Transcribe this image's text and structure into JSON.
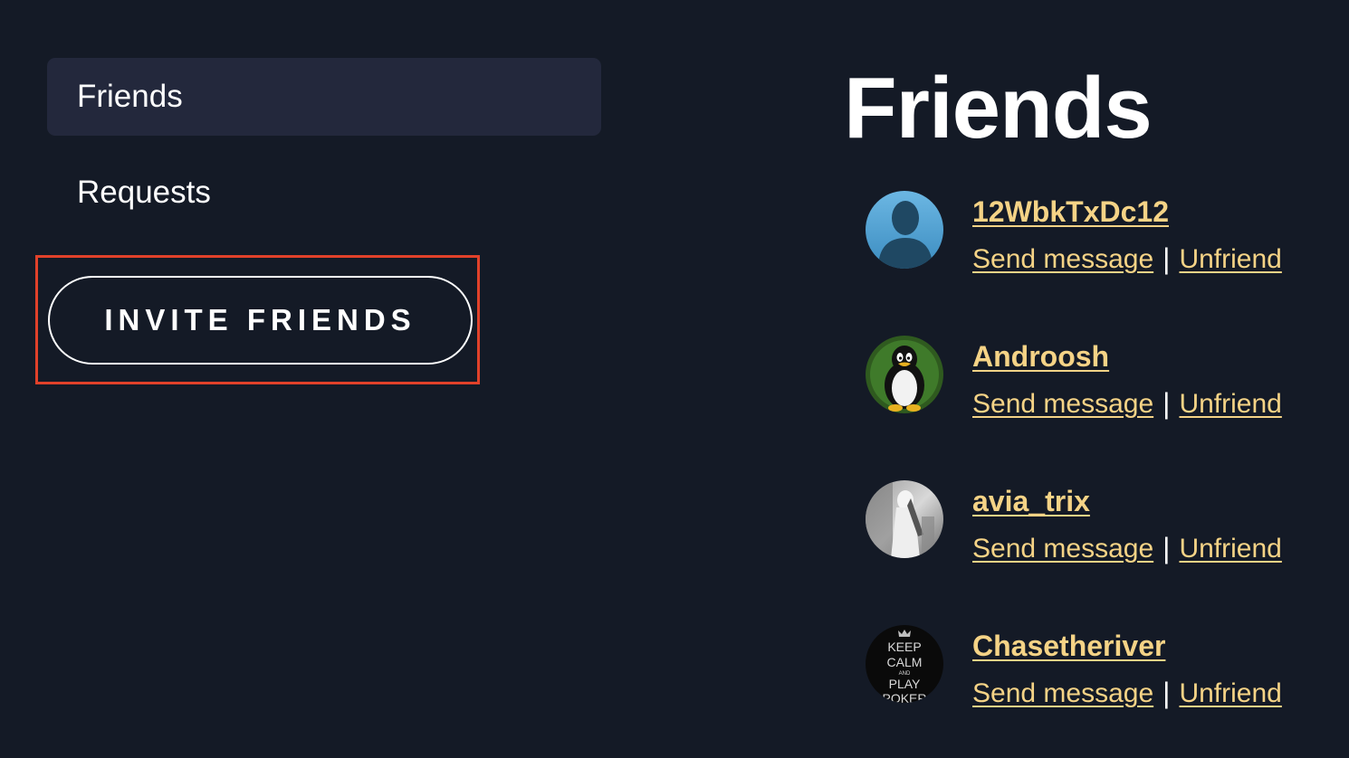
{
  "sidebar": {
    "items": [
      {
        "label": "Friends",
        "active": true
      },
      {
        "label": "Requests",
        "active": false
      }
    ],
    "invite_button_label": "INVITE FRIENDS"
  },
  "main": {
    "title": "Friends",
    "friends": [
      {
        "name": "12WbkTxDc12",
        "avatar": "default-silhouette-avatar",
        "send_message_label": "Send message",
        "separator": "|",
        "unfriend_label": "Unfriend"
      },
      {
        "name": "Androosh",
        "avatar": "penguin-avatar",
        "send_message_label": "Send message",
        "separator": "|",
        "unfriend_label": "Unfriend"
      },
      {
        "name": "avia_trix",
        "avatar": "photo-avatar",
        "send_message_label": "Send message",
        "separator": "|",
        "unfriend_label": "Unfriend"
      },
      {
        "name": "Chasetheriver",
        "avatar": "keep-calm-avatar",
        "avatar_text": [
          "KEEP",
          "CALM",
          "AND",
          "PLAY",
          "POKER"
        ],
        "send_message_label": "Send message",
        "separator": "|",
        "unfriend_label": "Unfriend"
      }
    ]
  },
  "colors": {
    "background": "#141a26",
    "active_nav": "#23283c",
    "link": "#f5d386",
    "highlight": "#e1412a"
  }
}
